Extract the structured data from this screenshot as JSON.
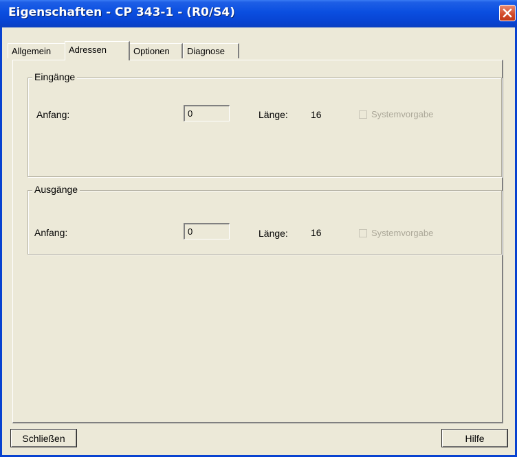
{
  "window": {
    "title": "Eigenschaften - CP 343-1 - (R0/S4)",
    "close_icon": "close-icon"
  },
  "tabs": [
    {
      "label": "Allgemein",
      "active": false
    },
    {
      "label": "Adressen",
      "active": true
    },
    {
      "label": "Optionen",
      "active": false
    },
    {
      "label": "Diagnose",
      "active": false
    }
  ],
  "inputs_group": {
    "title": "Eingänge",
    "start_label": "Anfang:",
    "start_value": "0",
    "length_label": "Länge:",
    "length_value": "16",
    "default_checkbox_label": "Systemvorgabe",
    "default_checked": false
  },
  "outputs_group": {
    "title": "Ausgänge",
    "start_label": "Anfang:",
    "start_value": "0",
    "length_label": "Länge:",
    "length_value": "16",
    "default_checkbox_label": "Systemvorgabe",
    "default_checked": false
  },
  "buttons": {
    "close_label": "Schließen",
    "help_label": "Hilfe"
  },
  "colors": {
    "titlebar": "#0a4ee0",
    "dialog_bg": "#ece9d8",
    "close_button": "#d24a2a",
    "disabled_text": "#aca899"
  }
}
